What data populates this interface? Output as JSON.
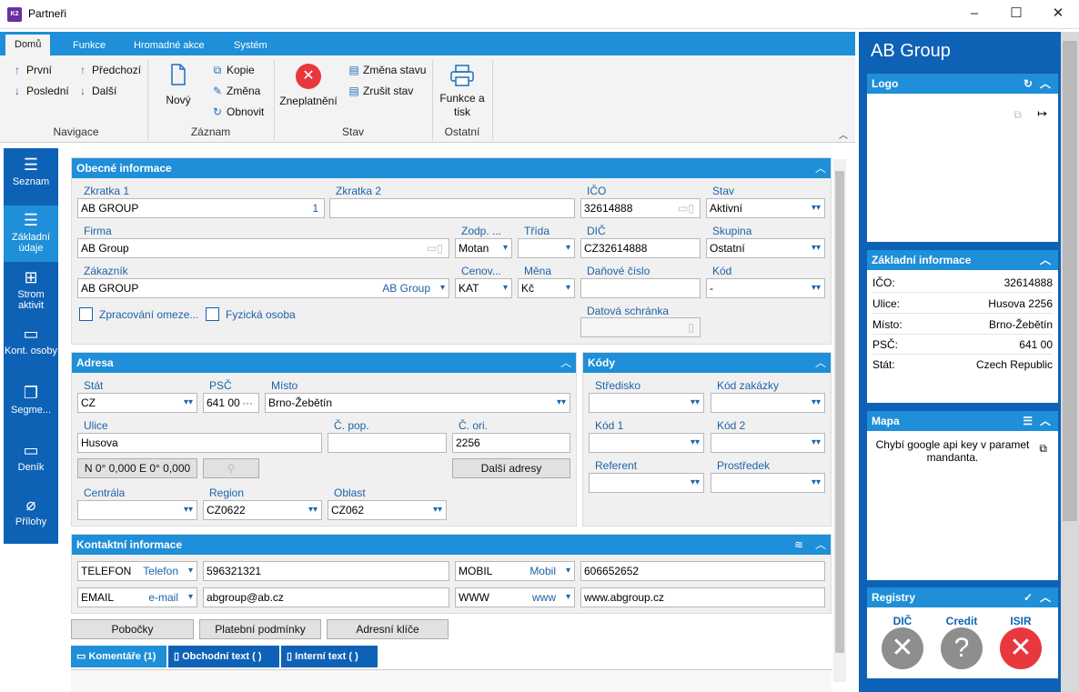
{
  "window": {
    "title": "Partneři",
    "app_icon": "K2",
    "minimize": "–",
    "maximize": "☐",
    "close": "✕"
  },
  "ribbon": {
    "tabs": [
      {
        "label": "Domů"
      },
      {
        "label": "Funkce"
      },
      {
        "label": "Hromadné akce"
      },
      {
        "label": "Systém"
      }
    ],
    "nav": {
      "first": "První",
      "prev": "Předchozí",
      "last": "Poslední",
      "next": "Další",
      "group": "Navigace"
    },
    "record": {
      "new": "Nový",
      "copy": "Kopie",
      "change": "Změna",
      "refresh": "Obnovit",
      "group": "Záznam"
    },
    "state": {
      "invalidate": "Zneplatnění",
      "change_state": "Změna stavu",
      "cancel_state": "Zrušit stav",
      "group": "Stav"
    },
    "other": {
      "print": "Funkce a tisk",
      "group": "Ostatní"
    }
  },
  "leftnav": [
    {
      "label": "Seznam"
    },
    {
      "label": "Základní údaje"
    },
    {
      "label": "Strom aktivit"
    },
    {
      "label": "Kont. osoby"
    },
    {
      "label": "Segme..."
    },
    {
      "label": "Deník"
    },
    {
      "label": "Přílohy"
    }
  ],
  "general": {
    "title": "Obecné informace",
    "zkratka1_label": "Zkratka 1",
    "zkratka1": "AB GROUP",
    "zkratka1_num": "1",
    "zkratka2_label": "Zkratka 2",
    "zkratka2": "",
    "ico_label": "IČO",
    "ico": "32614888",
    "stav_label": "Stav",
    "stav": "Aktivní",
    "firma_label": "Firma",
    "firma": "AB Group",
    "zodp_label": "Zodp. ...",
    "zodp": "Motan",
    "trida_label": "Třída",
    "trida": "",
    "dic_label": "DIČ",
    "dic": "CZ32614888",
    "skupina_label": "Skupina",
    "skupina": "Ostatní",
    "zakaznik_label": "Zákazník",
    "zakaznik": "AB GROUP",
    "zakaznik_ref": "AB Group",
    "cenov_label": "Cenov...",
    "cenov": "KAT",
    "mena_label": "Měna",
    "mena": "Kč",
    "danove_label": "Daňové číslo",
    "danove": "",
    "kod_label": "Kód",
    "kod": "-",
    "zprac_label": "Zpracování omeze...",
    "fyz_label": "Fyzická osoba",
    "datova_label": "Datová schránka",
    "datova": ""
  },
  "address": {
    "title": "Adresa",
    "stat_label": "Stát",
    "stat": "CZ",
    "psc_label": "PSČ",
    "psc": "641 00",
    "misto_label": "Místo",
    "misto": "Brno-Žebětín",
    "ulice_label": "Ulice",
    "ulice": "Husova",
    "cpop_label": "Č. pop.",
    "cpop": "",
    "cori_label": "Č. ori.",
    "cori": "2256",
    "gps": "N 0° 0,000 E 0° 0,000",
    "more": "Další adresy",
    "centrala_label": "Centrála",
    "centrala": "",
    "region_label": "Region",
    "region": "CZ0622",
    "oblast_label": "Oblast",
    "oblast": "CZ062"
  },
  "codes": {
    "title": "Kódy",
    "stredisko_label": "Středisko",
    "kodzak_label": "Kód zakázky",
    "kod1_label": "Kód 1",
    "kod2_label": "Kód 2",
    "referent_label": "Referent",
    "prostredek_label": "Prostředek"
  },
  "contact": {
    "title": "Kontaktní informace",
    "rows": [
      {
        "type": "TELEFON",
        "kind": "Telefon",
        "value": "596321321",
        "type2": "MOBIL",
        "kind2": "Mobil",
        "value2": "606652652"
      },
      {
        "type": "EMAIL",
        "kind": "e-mail",
        "value": "abgroup@ab.cz",
        "type2": "WWW",
        "kind2": "www",
        "value2": "www.abgroup.cz"
      }
    ]
  },
  "buttons": {
    "branches": "Pobočky",
    "payment": "Platební podmínky",
    "addr_keys": "Adresní klíče"
  },
  "bottom_tabs": {
    "comments": "Komentáře (1)",
    "business": "Obchodní text ( )",
    "internal": "Interní text ( )"
  },
  "right": {
    "title": "AB Group",
    "logo": "Logo",
    "basic": {
      "title": "Základní informace",
      "rows": [
        {
          "k": "IČO:",
          "v": "32614888"
        },
        {
          "k": "Ulice:",
          "v": "Husova 2256"
        },
        {
          "k": "Místo:",
          "v": "Brno-Žebětín"
        },
        {
          "k": "PSČ:",
          "v": "641 00"
        },
        {
          "k": "Stát:",
          "v": "Czech Republic"
        }
      ]
    },
    "map": {
      "title": "Mapa",
      "msg": "Chybí google api key v paramet mandanta."
    },
    "registry": {
      "title": "Registry",
      "dic": "DIČ",
      "credit": "Credit",
      "isir": "ISIR"
    }
  }
}
